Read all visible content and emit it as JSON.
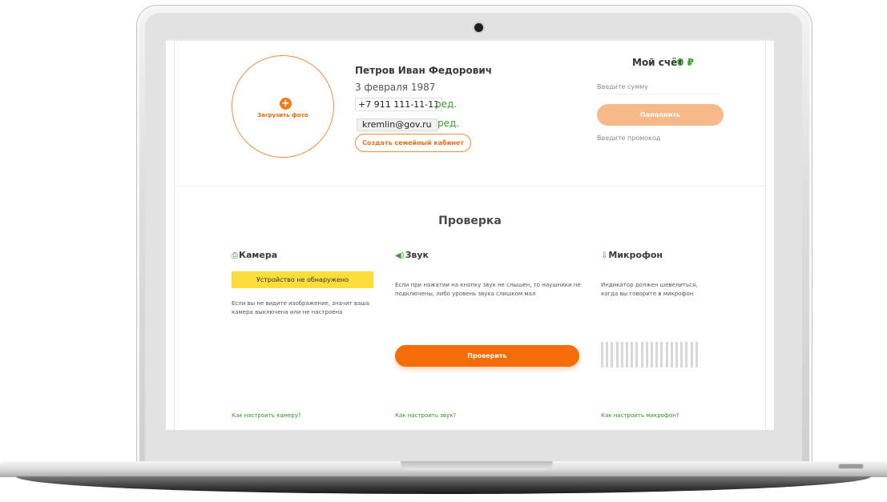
{
  "profile": {
    "upload_photo": "Загрузить фото",
    "name": "Петров Иван Федорович",
    "birth_date": "3 февраля 1987",
    "phone": "+7 911 111-11-11",
    "phone_edit": "ред.",
    "email": "kremlin@gov.ru",
    "email_edit": "ред.",
    "family_button": "Создать семейный кабинет"
  },
  "account": {
    "title": "Мой счёт",
    "balance": "0 ₽",
    "amount_placeholder": "Введите сумму",
    "topup_button": "Пополнить",
    "promo_placeholder": "Введите промокод"
  },
  "check": {
    "title": "Проверка",
    "camera": {
      "icon": "camera-icon",
      "title": "Камера",
      "status": "Устройство не обнаружено",
      "description": "Если вы не видите изображение, значит ваша камера выключена или не настроена",
      "help_link": "Как настроить камеру?"
    },
    "sound": {
      "icon": "speaker-icon",
      "title": "Звук",
      "description": "Если при нажатии на кнопку звук не слышен, то наушники не подключены, либо уровень звука слишком мал",
      "check_button": "Проверить",
      "help_link": "Как настроить звук?"
    },
    "mic": {
      "icon": "microphone-icon",
      "title": "Микрофон",
      "description": "Индикатор должен шевелиться, когда вы говорите в микрофон",
      "level": 0,
      "help_link": "Как настроить микрофон?"
    }
  },
  "colors": {
    "accent": "#f36c08",
    "accent_light": "#f7b98a",
    "green": "#3b9b2f",
    "warning": "#fddc3e"
  }
}
